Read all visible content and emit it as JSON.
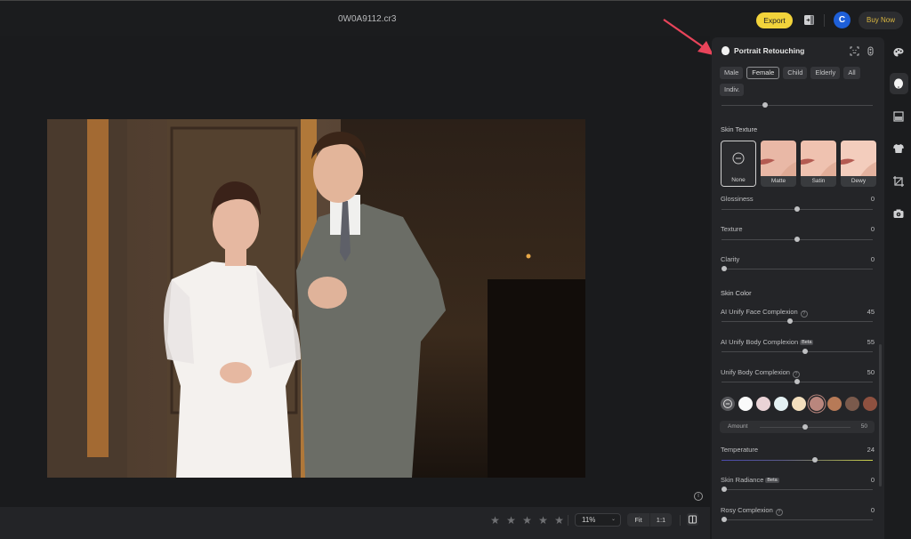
{
  "topbar": {
    "filename": "0W0A9112.cr3",
    "export_label": "Export",
    "avatar_initial": "C",
    "buy_label": "Buy Now"
  },
  "canvas": {
    "info_glyph": "i"
  },
  "bottombar": {
    "rating_max": 5,
    "rating": 0,
    "star_glyph": "★",
    "zoom_level": "11%",
    "zoom_chevron": "⌄",
    "fit_label": "Fit",
    "one_to_one_label": "1:1"
  },
  "panel": {
    "title": "Portrait Retouching",
    "filters": [
      {
        "label": "Male",
        "active": false
      },
      {
        "label": "Female",
        "active": true
      },
      {
        "label": "Child",
        "active": false
      },
      {
        "label": "Elderly",
        "active": false
      },
      {
        "label": "All",
        "active": false
      },
      {
        "label": "Indiv.",
        "active": false
      }
    ],
    "top_slider_value": 0.29,
    "skin_texture": {
      "title": "Skin Texture",
      "options": [
        {
          "label": "None",
          "selected": true
        },
        {
          "label": "Matte",
          "selected": false
        },
        {
          "label": "Satin",
          "selected": false
        },
        {
          "label": "Dewy",
          "selected": false
        }
      ],
      "sliders": [
        {
          "label": "Glossiness",
          "value": "0",
          "position": 0.5
        },
        {
          "label": "Texture",
          "value": "0",
          "position": 0.5
        },
        {
          "label": "Clarity",
          "value": "0",
          "position": 0.0
        }
      ]
    },
    "skin_color": {
      "title": "Skin Color",
      "sliders": [
        {
          "label": "AI Unify Face Complexion",
          "value": "45",
          "position": 0.45,
          "help": true,
          "beta": false
        },
        {
          "label": "AI Unify Body Complexion",
          "value": "55",
          "position": 0.55,
          "help": false,
          "beta": true
        },
        {
          "label": "Unify Body Complexion",
          "value": "50",
          "position": 0.5,
          "help": true,
          "beta": false
        }
      ],
      "swatches": [
        "none",
        "#fafafa",
        "#ead3d6",
        "#e4f1f3",
        "#f3dfbe",
        "#b9867d",
        "#b77a57",
        "#7a5a4c",
        "#8e5140"
      ],
      "selected_swatch": 5,
      "amount": {
        "label": "Amount",
        "value": "50",
        "position": 0.5
      },
      "temperature": {
        "label": "Temperature",
        "value": "24",
        "position": 0.62
      },
      "skin_radiance": {
        "label": "Skin Radiance",
        "value": "0",
        "position": 0.0,
        "beta": true
      },
      "rosy": {
        "label": "Rosy Complexion",
        "value": "0",
        "position": 0.0,
        "help": true
      }
    },
    "beta_label": "Beta",
    "help_glyph": "?"
  },
  "rail": {
    "items": [
      "palette-icon",
      "portrait-icon",
      "background-icon",
      "clothing-icon",
      "crop-icon",
      "camera-icon"
    ],
    "active": 1
  },
  "colors": {
    "accent_export": "#f2d33b",
    "avatar_blue": "#1e5fd8",
    "buy_text": "#d9b640",
    "annotation_arrow": "#e8445a"
  }
}
